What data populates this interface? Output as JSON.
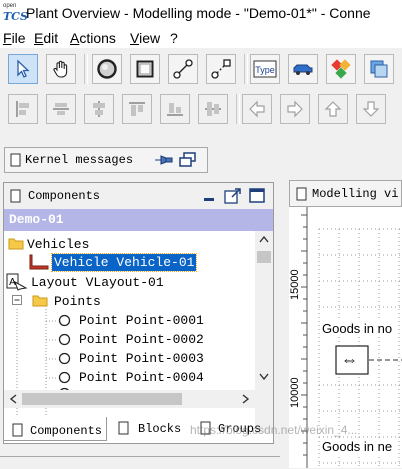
{
  "window": {
    "app_icon_small": "open",
    "app_icon_big": "TCS",
    "title": "Plant Overview - Modelling mode - \"Demo-01*\" - Conne"
  },
  "menu": [
    "File",
    "Edit",
    "Actions",
    "View",
    "?"
  ],
  "toolbar": {
    "row1": [
      "select-arrow-icon",
      "hand-pan-icon",
      "point-tool-icon",
      "location-tool-icon",
      "path-tool-icon",
      "link-tool-icon",
      "location-type-icon",
      "vehicle-icon",
      "block-icon",
      "group-icon"
    ],
    "row2": [
      "align-left-icon",
      "align-center-h-icon",
      "align-center-v-icon",
      "align-top-icon",
      "align-bottom-icon",
      "align-middle-icon",
      "move-left-icon",
      "move-right-icon",
      "move-up-icon",
      "move-down-icon"
    ],
    "location_type_label": "Type"
  },
  "kernel": {
    "label": "Kernel messages"
  },
  "components": {
    "title": "Components",
    "model": "Demo-01",
    "tree": [
      {
        "label": "Vehicles",
        "kind": "folder"
      },
      {
        "label": "Vehicle Vehicle-01",
        "kind": "vehicle",
        "selected": true
      },
      {
        "label": "Layout VLayout-01",
        "kind": "layout"
      },
      {
        "label": "Points",
        "kind": "folder"
      },
      {
        "label": "Point Point-0001",
        "kind": "point"
      },
      {
        "label": "Point Point-0002",
        "kind": "point"
      },
      {
        "label": "Point Point-0003",
        "kind": "point"
      },
      {
        "label": "Point Point-0004",
        "kind": "point"
      }
    ],
    "tabs": [
      "Components",
      "Blocks",
      "Groups"
    ]
  },
  "modelling": {
    "tab_label": "Modelling vi",
    "y_ticks": [
      "15000",
      "10000"
    ],
    "location_labels": [
      "Goods in no",
      "Goods in ne"
    ],
    "location_symbol": "⇔"
  },
  "watermark": "https://blog.csdn.net/weixin_4..."
}
